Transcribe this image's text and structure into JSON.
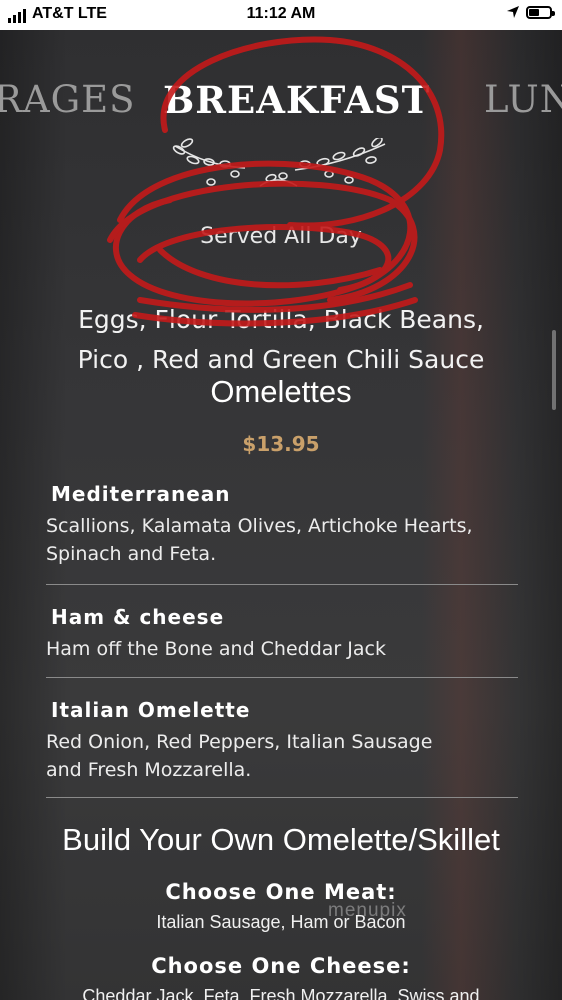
{
  "status_bar": {
    "carrier": "AT&T LTE",
    "time": "11:12 AM",
    "battery_level": 0.55
  },
  "menu": {
    "tabs": [
      "RAGES",
      "BREAKFAST",
      "LUN"
    ],
    "active_tab": "BREAKFAST",
    "subtitle": "Served All Day",
    "description_line1": "Eggs, Flour Tortilla, Black Beans,",
    "description_line2": "Pico , Red and Green Chili Sauce",
    "section_title": "Omelettes",
    "price": "$13.95",
    "items": [
      {
        "name": "Mediterranean",
        "description_line1": "Scallions, Kalamata Olives, Artichoke Hearts,",
        "description_line2": "Spinach and Feta."
      },
      {
        "name": "Ham & cheese",
        "description_line1": "Ham off the Bone and Cheddar Jack",
        "description_line2": ""
      },
      {
        "name": "Italian Omelette",
        "description_line1": "Red Onion, Red Peppers, Italian Sausage",
        "description_line2": "and Fresh Mozzarella."
      }
    ],
    "build_title": "Build Your Own Omelette/Skillet",
    "meat_heading": "Choose One Meat:",
    "meat_options": "Italian Sausage, Ham or Bacon",
    "cheese_heading": "Choose One Cheese:",
    "cheese_options": "Cheddar Jack, Feta, Fresh Mozzarella, Swiss and"
  },
  "watermark": "menupix",
  "colors": {
    "accent_price": "#c9a06a",
    "annotation_red": "#c41a1a",
    "background": "#333334"
  },
  "icons": [
    "signal-icon",
    "location-arrow-icon",
    "battery-icon",
    "floral-ornament-icon"
  ]
}
